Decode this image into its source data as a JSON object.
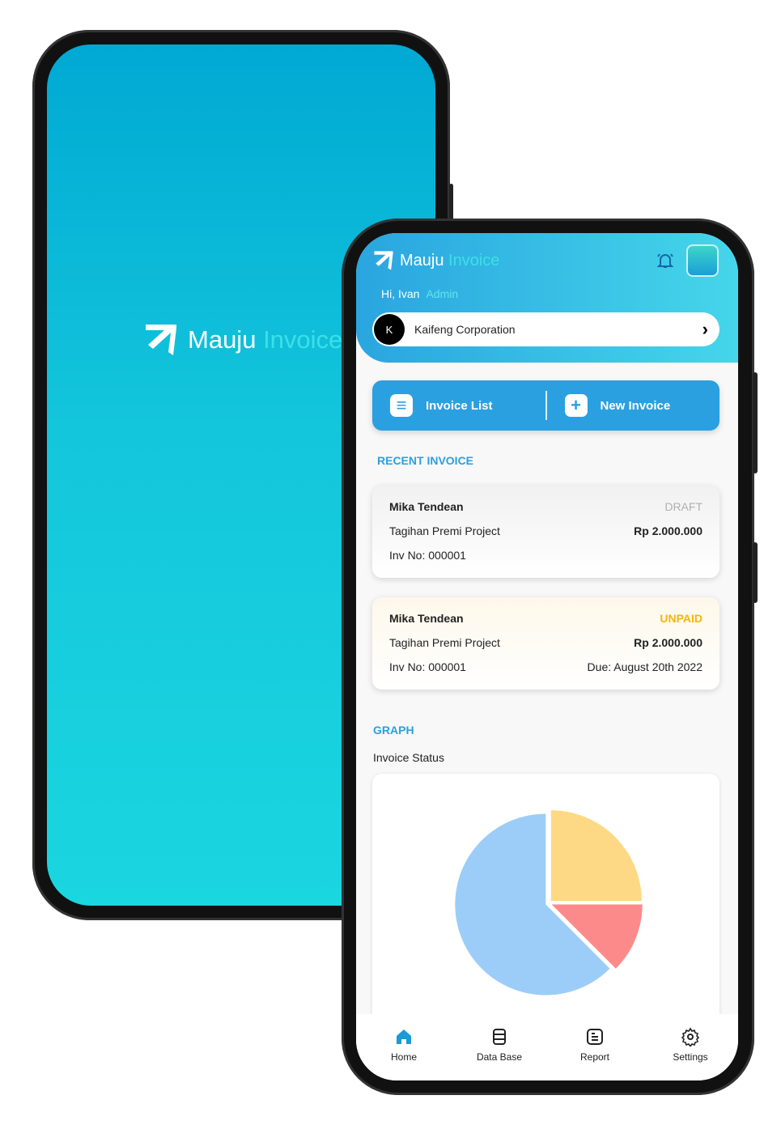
{
  "brand": {
    "name_part1": "Mauju",
    "name_part2": "Invoice"
  },
  "header": {
    "greeting": "Hi, Ivan",
    "role": "Admin",
    "company_initial": "K",
    "company_name": "Kaifeng Corporation"
  },
  "actions": {
    "invoice_list": "Invoice List",
    "new_invoice": "New Invoice"
  },
  "recent": {
    "title": "RECENT INVOICE",
    "invoices": [
      {
        "client": "Mika Tendean",
        "status": "DRAFT",
        "status_color": "#b0b0b0",
        "project": "Tagihan Premi Project",
        "amount": "Rp 2.000.000",
        "inv_no": "Inv No: 000001",
        "due": ""
      },
      {
        "client": "Mika Tendean",
        "status": "UNPAID",
        "status_color": "#f5b50a",
        "project": "Tagihan Premi Project",
        "amount": "Rp 2.000.000",
        "inv_no": "Inv No: 000001",
        "due": "Due:  August 20th 2022"
      }
    ]
  },
  "graph": {
    "title": "GRAPH",
    "subtitle": "Invoice Status"
  },
  "chart_data": {
    "type": "pie",
    "values": [
      25,
      12.5,
      62.5
    ],
    "colors": [
      "#fdd985",
      "#fd8a8a",
      "#9ccdf8"
    ]
  },
  "nav": [
    {
      "label": "Home",
      "icon": "home-icon",
      "active": true
    },
    {
      "label": "Data Base",
      "icon": "database-icon"
    },
    {
      "label": "Report",
      "icon": "report-icon"
    },
    {
      "label": "Settings",
      "icon": "gear-icon"
    }
  ],
  "colors": {
    "accent": "#2aa0e0",
    "active_nav": "#1a9ad6"
  }
}
